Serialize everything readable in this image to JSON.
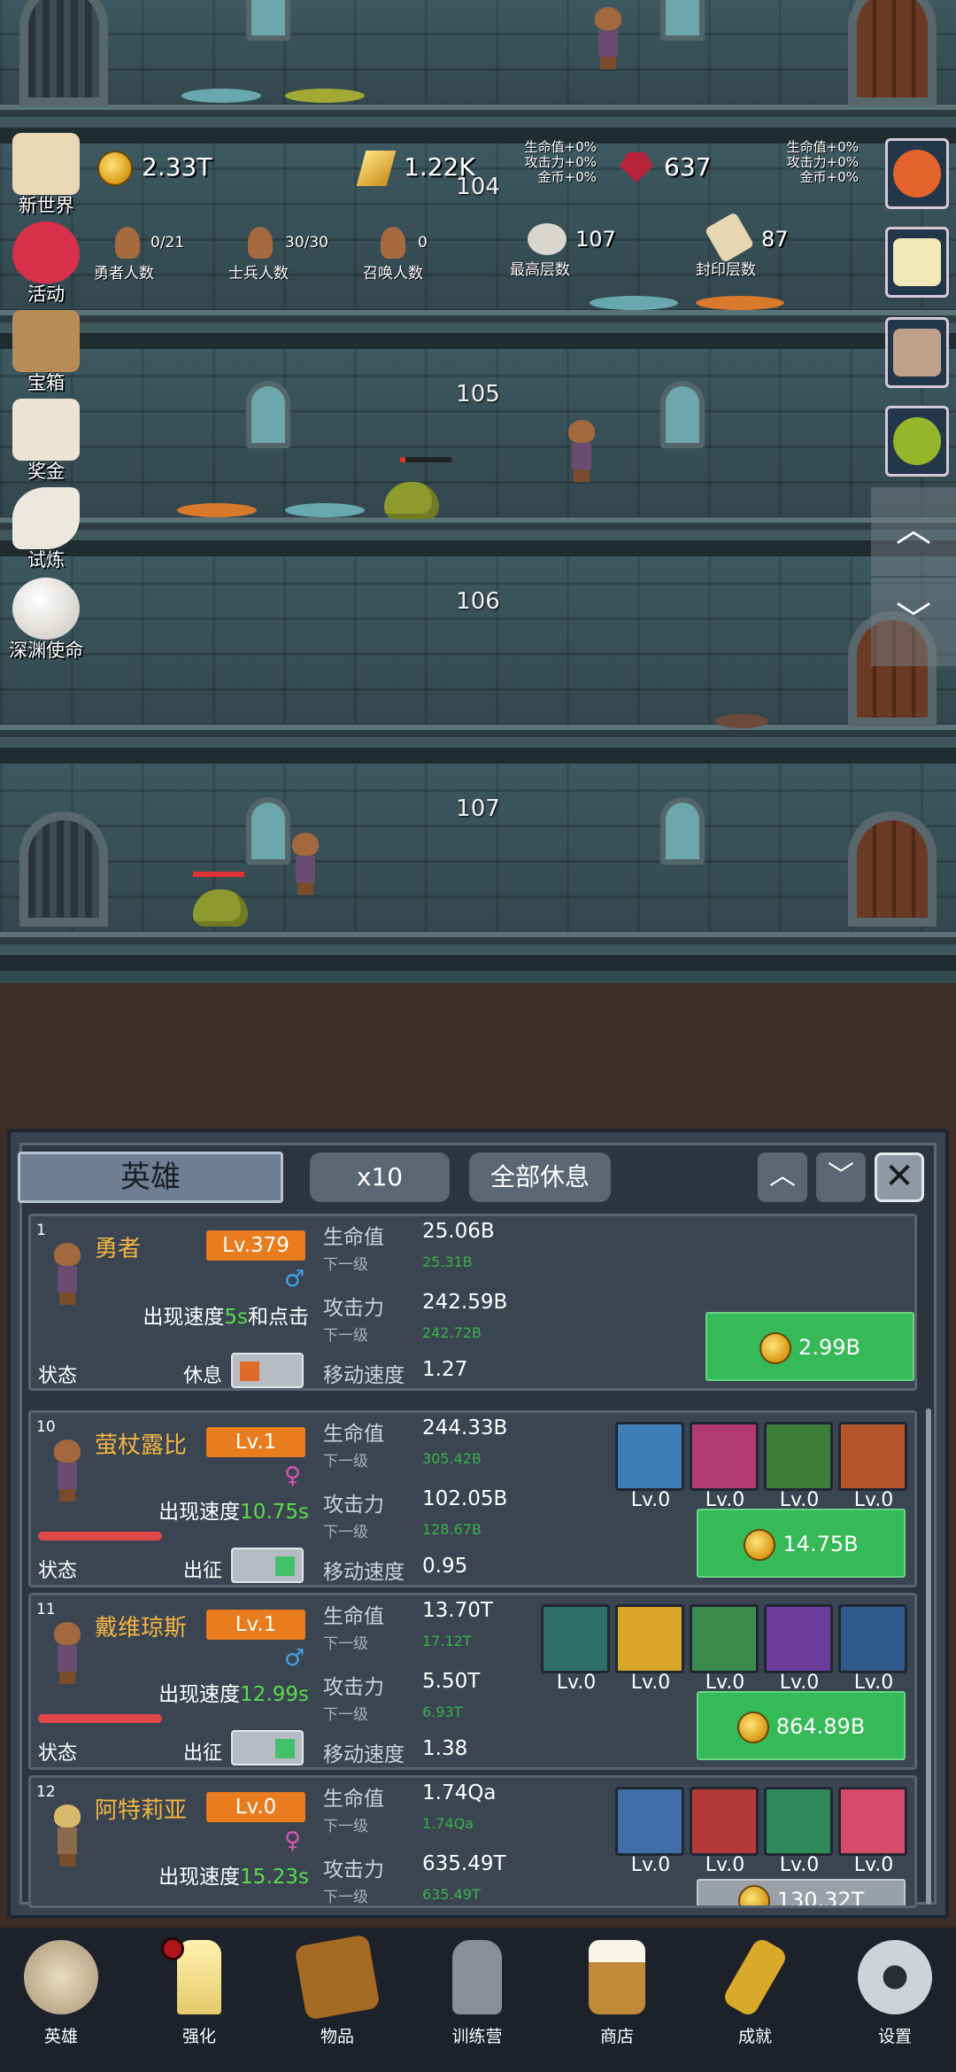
{
  "colors": {
    "accent_orange": "#e97c1e",
    "buy_green": "#36b957",
    "name_gold": "#f3b643",
    "speed_green": "#5bdc4c",
    "next_green": "#39b34a"
  },
  "floors": [
    {
      "label": "104"
    },
    {
      "label": "105"
    },
    {
      "label": "106"
    },
    {
      "label": "107"
    }
  ],
  "resources": {
    "coins": "2.33T",
    "gold_bar": "1.22K",
    "gem": "637",
    "bonus_left": [
      "生命值+0%",
      "攻击力+0%",
      "金币+0%"
    ],
    "bonus_right": [
      "生命值+0%",
      "攻击力+0%",
      "金币+0%"
    ]
  },
  "counts": [
    {
      "value": "0/21",
      "label": "勇者人数"
    },
    {
      "value": "30/30",
      "label": "士兵人数"
    },
    {
      "value": "0",
      "label": "召唤人数"
    }
  ],
  "floors_stats": [
    {
      "value": "107",
      "label": "最高层数"
    },
    {
      "value": "87",
      "label": "封印层数"
    }
  ],
  "side_menu": [
    "新世界",
    "活动",
    "宝箱",
    "奖金",
    "试炼",
    "深渊使命"
  ],
  "side_icons": [
    "map-icon",
    "heart-icon",
    "chest-icon",
    "envelope-icon",
    "feather-icon",
    "pearl-icon"
  ],
  "buffs": [
    "apple-icon",
    "candle-icon",
    "chest-buff-icon",
    "slime-buff-icon"
  ],
  "panel": {
    "tab": "英雄",
    "x10": "x10",
    "rest_all": "全部休息",
    "up": "︿",
    "down": "﹀",
    "close": "✕"
  },
  "heroes": [
    {
      "index": "1",
      "name": "勇者",
      "level": "Lv.379",
      "gender": "♂",
      "spawn_prefix": "出现速度",
      "spawn_speed": "5s",
      "spawn_suffix": "和点击",
      "hp": "25.06B",
      "hp_next": "25.31B",
      "atk": "242.59B",
      "atk_next": "242.72B",
      "move": "1.27",
      "state_label": "状态",
      "state_value": "休息",
      "cost": "2.99B"
    },
    {
      "index": "10",
      "name": "萤杖露比",
      "level": "Lv.1",
      "gender": "♀",
      "spawn_prefix": "出现速度",
      "spawn_speed": "10.75s",
      "spawn_suffix": "",
      "hp": "244.33B",
      "hp_next": "305.42B",
      "atk": "102.05B",
      "atk_next": "128.67B",
      "move": "0.95",
      "state_label": "状态",
      "state_value": "出征",
      "cost": "14.75B",
      "skills": [
        "Lv.0",
        "Lv.0",
        "Lv.0",
        "Lv.0"
      ]
    },
    {
      "index": "11",
      "name": "戴维琼斯",
      "level": "Lv.1",
      "gender": "♂",
      "spawn_prefix": "出现速度",
      "spawn_speed": "12.99s",
      "spawn_suffix": "",
      "hp": "13.70T",
      "hp_next": "17.12T",
      "atk": "5.50T",
      "atk_next": "6.93T",
      "move": "1.38",
      "state_label": "状态",
      "state_value": "出征",
      "cost": "864.89B",
      "skills": [
        "Lv.0",
        "Lv.0",
        "Lv.0",
        "Lv.0",
        "Lv.0"
      ]
    },
    {
      "index": "12",
      "name": "阿特莉亚",
      "level": "Lv.0",
      "gender": "♀",
      "spawn_prefix": "出现速度",
      "spawn_speed": "15.23s",
      "spawn_suffix": "",
      "hp": "1.74Qa",
      "hp_next": "1.74Qa",
      "atk": "635.49T",
      "atk_next": "635.49T",
      "cost": "130.32T",
      "skills": [
        "Lv.0",
        "Lv.0",
        "Lv.0",
        "Lv.0"
      ]
    }
  ],
  "stat_labels": {
    "hp": "生命值",
    "next": "下一级",
    "atk": "攻击力",
    "move": "移动速度"
  },
  "nav": [
    {
      "label": "英雄",
      "icon": "skull-icon"
    },
    {
      "label": "强化",
      "icon": "candle-icon"
    },
    {
      "label": "物品",
      "icon": "book-icon"
    },
    {
      "label": "训练营",
      "icon": "lantern-icon"
    },
    {
      "label": "商店",
      "icon": "mug-icon"
    },
    {
      "label": "成就",
      "icon": "key-icon"
    },
    {
      "label": "设置",
      "icon": "gear-icon"
    }
  ]
}
